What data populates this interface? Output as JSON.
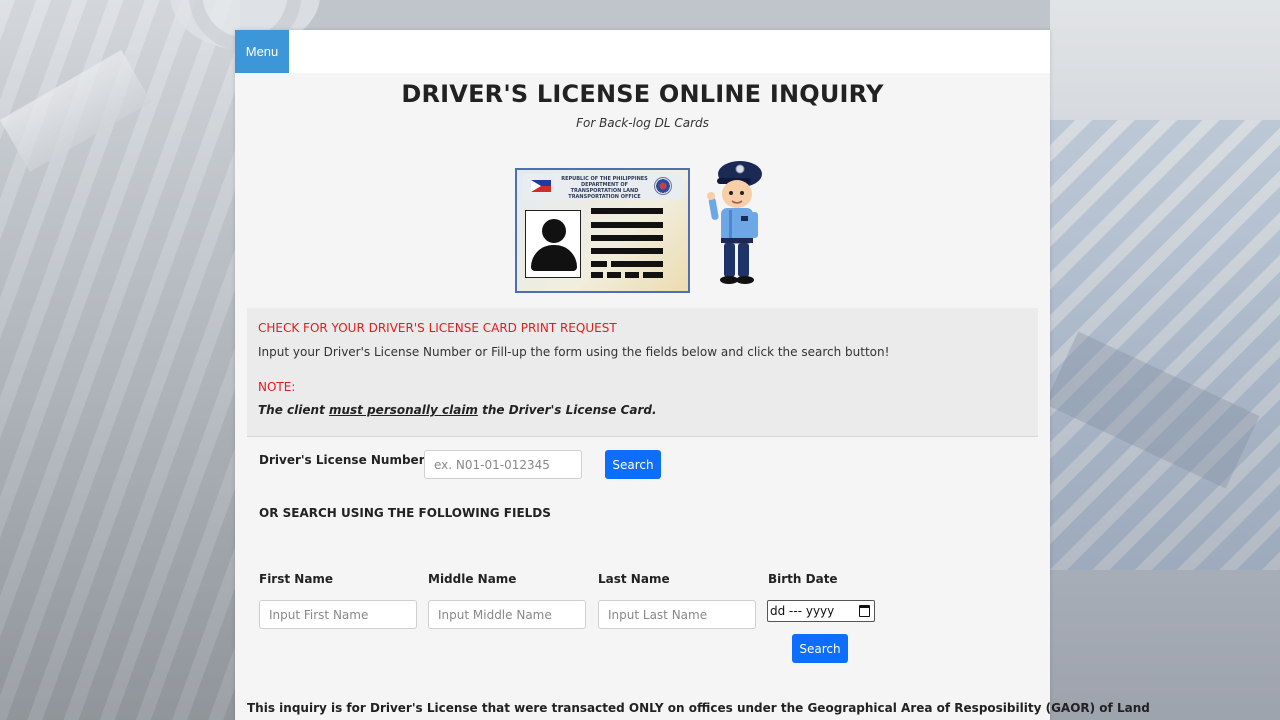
{
  "nav": {
    "menu_label": "Menu"
  },
  "header": {
    "title": "DRIVER'S LICENSE ONLINE INQUIRY",
    "subtitle": "For Back-log DL Cards"
  },
  "card": {
    "header_text": "REPUBLIC OF THE PHILIPPINES DEPARTMENT OF TRANSPORTATION LAND TRANSPORTATION OFFICE"
  },
  "info": {
    "heading": "CHECK FOR YOUR DRIVER'S LICENSE CARD PRINT REQUEST",
    "instruction": "Input your Driver's License Number or Fill-up the form using the fields below and click the search button!",
    "note_label": "NOTE:",
    "claim_prefix": "The client ",
    "claim_emphasis": "must personally claim",
    "claim_suffix": " the Driver's License Card."
  },
  "license_search": {
    "label": "Driver's License Number:",
    "placeholder": "ex. N01-01-012345",
    "button": "Search"
  },
  "field_search": {
    "heading": "OR SEARCH USING THE FOLLOWING FIELDS",
    "first_name": {
      "label": "First Name",
      "placeholder": "Input First Name"
    },
    "middle_name": {
      "label": "Middle Name",
      "placeholder": "Input Middle Name"
    },
    "last_name": {
      "label": "Last Name",
      "placeholder": "Input Last Name"
    },
    "birth_date": {
      "label": "Birth Date",
      "value": "dd --- yyyy"
    },
    "button": "Search"
  },
  "footer": {
    "text": "This inquiry is for Driver's License that were transacted ONLY on offices under the Geographical Area of Resposibility (GAOR) of Land"
  },
  "icons": {
    "calendar": "calendar-icon",
    "avatar": "person-silhouette-icon",
    "flag": "philippine-flag-icon"
  },
  "colors": {
    "menu": "#3c96d8",
    "primary_button": "#0d6efd",
    "alert_text": "#e11d1d"
  }
}
